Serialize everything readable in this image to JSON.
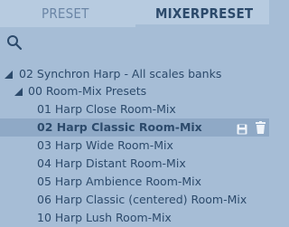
{
  "tabs": {
    "preset": "PRESET",
    "mixerpreset": "MIXERPRESET"
  },
  "search": {
    "icon": "search-icon"
  },
  "tree": {
    "root": {
      "label": "02 Synchron Harp - All scales banks",
      "expanded": true
    },
    "folder": {
      "label": "00 Room-Mix Presets",
      "expanded": true
    },
    "items": [
      {
        "label": "01 Harp Close Room-Mix",
        "selected": false
      },
      {
        "label": "02 Harp Classic Room-Mix",
        "selected": true
      },
      {
        "label": "03 Harp Wide Room-Mix",
        "selected": false
      },
      {
        "label": "04 Harp Distant Room-Mix",
        "selected": false
      },
      {
        "label": "05 Harp Ambience Room-Mix",
        "selected": false
      },
      {
        "label": "06 Harp Classic (centered) Room-Mix",
        "selected": false
      },
      {
        "label": "10 Harp Lush Room-Mix",
        "selected": false
      }
    ]
  },
  "selected_row_icons": {
    "save": "save-icon",
    "delete": "trash-icon"
  },
  "colors": {
    "background": "#a6bdd6",
    "text": "#2c4a6b",
    "selection": "#8fa9c6",
    "inactive_tab": "#6b86a6"
  }
}
